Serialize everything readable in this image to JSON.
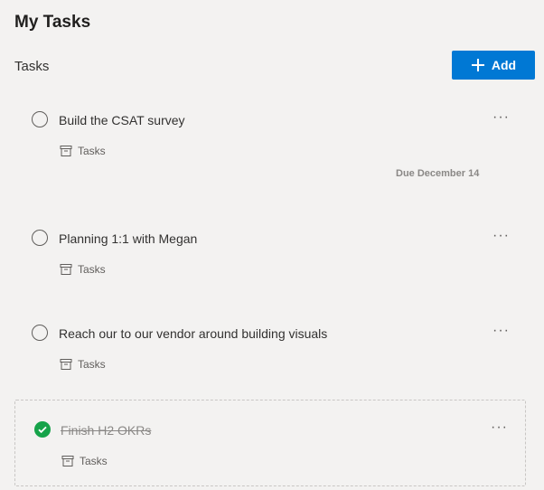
{
  "header": {
    "title": "My Tasks"
  },
  "section": {
    "label": "Tasks"
  },
  "toolbar": {
    "add_label": "Add",
    "accent": "#0078d4"
  },
  "tasks": [
    {
      "title": "Build the CSAT survey",
      "bucket": "Tasks",
      "due": "Due December 14",
      "completed": false,
      "more": "···"
    },
    {
      "title": "Planning 1:1 with Megan",
      "bucket": "Tasks",
      "completed": false,
      "more": "···"
    },
    {
      "title": "Reach our to our vendor around building visuals",
      "bucket": "Tasks",
      "completed": false,
      "more": "···"
    },
    {
      "title": "Finish H2 OKRs",
      "bucket": "Tasks",
      "completed": true,
      "more": "···"
    }
  ],
  "icons": {
    "add": "plus-icon",
    "bucket": "archive-icon",
    "complete": "check-icon",
    "incomplete": "circle-icon"
  },
  "status_colors": {
    "completed": "#16a34a"
  }
}
